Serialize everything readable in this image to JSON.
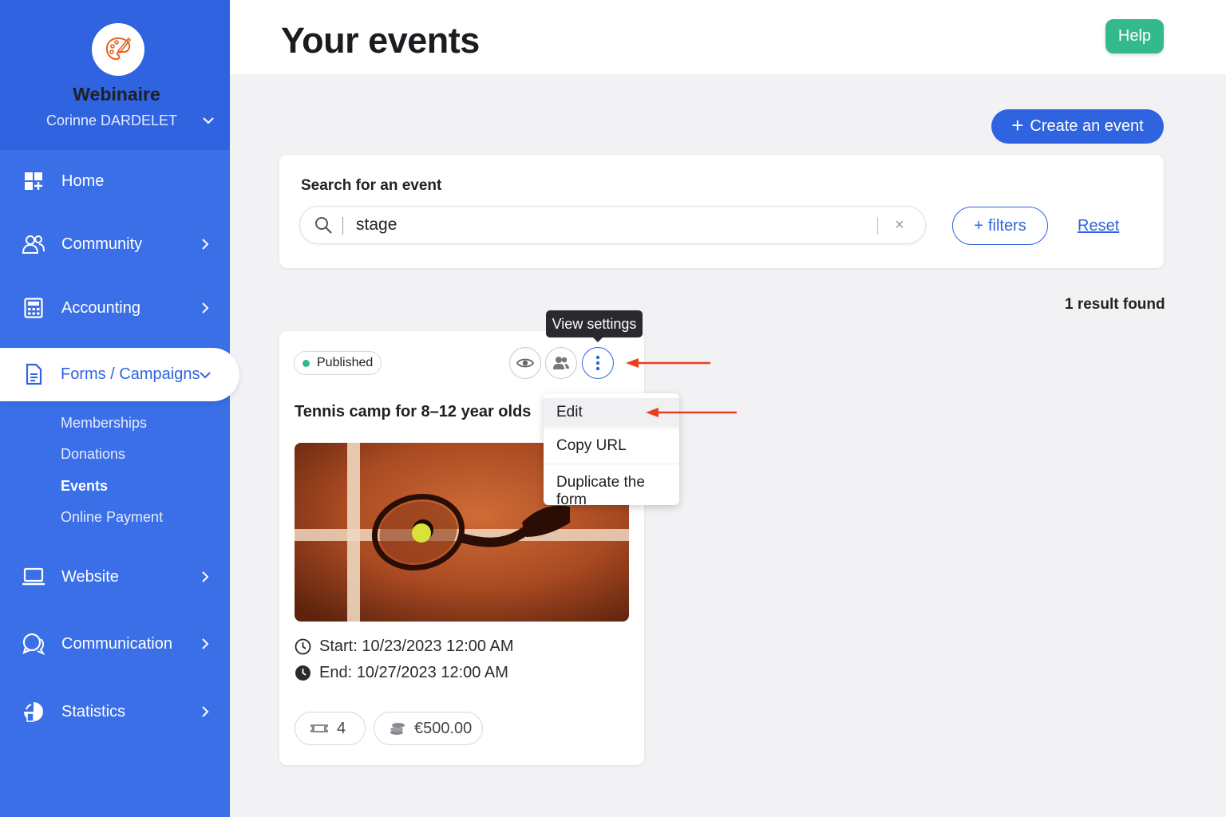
{
  "org": {
    "name": "Webinaire",
    "user": "Corinne DARDELET"
  },
  "nav": {
    "home": "Home",
    "community": "Community",
    "accounting": "Accounting",
    "forms": "Forms / Campaigns",
    "sub": {
      "memberships": "Memberships",
      "donations": "Donations",
      "events": "Events",
      "online_payment": "Online Payment"
    },
    "website": "Website",
    "communication": "Communication",
    "statistics": "Statistics"
  },
  "header": {
    "title": "Your events",
    "help": "Help"
  },
  "create_button": "Create an event",
  "search": {
    "label": "Search for an event",
    "value": "stage",
    "filters": "filters",
    "reset": "Reset"
  },
  "results": "1 result found",
  "event": {
    "status": "Published",
    "title": "Tennis camp for 8–12 year olds",
    "start": "Start: 10/23/2023 12:00 AM",
    "end": "End: 10/27/2023 12:00 AM",
    "tickets": "4",
    "amount": "€500.00"
  },
  "tooltip": "View settings",
  "menu": {
    "edit": "Edit",
    "copy_url": "Copy URL",
    "duplicate": "Duplicate the form"
  },
  "colors": {
    "primary": "#2f63e0",
    "sidebar": "#3a6fe8",
    "success": "#34b98d",
    "annotation": "#e8401c"
  }
}
